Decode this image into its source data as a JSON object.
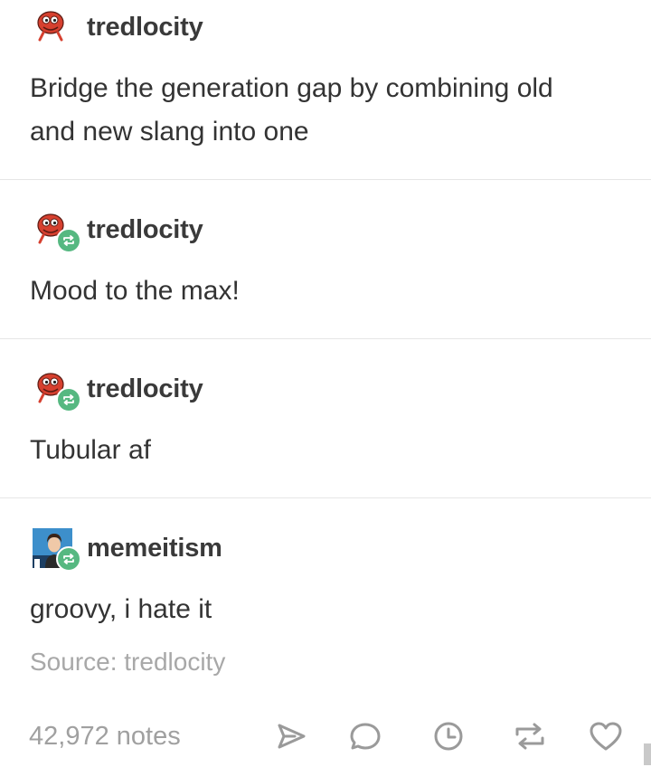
{
  "posts": [
    {
      "username": "tredlocity",
      "text_lines": [
        "Bridge the generation gap by combining old",
        "and new slang into one"
      ],
      "avatar_icon": "red-creature-mascot-icon",
      "reblog": false
    },
    {
      "username": "tredlocity",
      "text": "Mood to the max!",
      "avatar_icon": "red-creature-mascot-icon",
      "reblog": true
    },
    {
      "username": "tredlocity",
      "text": "Tubular af",
      "avatar_icon": "red-creature-mascot-icon",
      "reblog": true
    },
    {
      "username": "memeitism",
      "text": "groovy, i hate it",
      "avatar_icon": "portrait-photo-avatar",
      "reblog": true
    }
  ],
  "source": "Source: tredlocity",
  "footer": {
    "notes": "42,972 notes",
    "actions": [
      "share-icon",
      "reply-icon",
      "queue-clock-icon",
      "reblog-icon",
      "like-heart-icon"
    ]
  },
  "colors": {
    "reblog_green": "#56b881",
    "text": "#333333",
    "muted": "#a8a8a8",
    "divider": "#e6e6e6",
    "mascot_red": "#d6402f"
  }
}
